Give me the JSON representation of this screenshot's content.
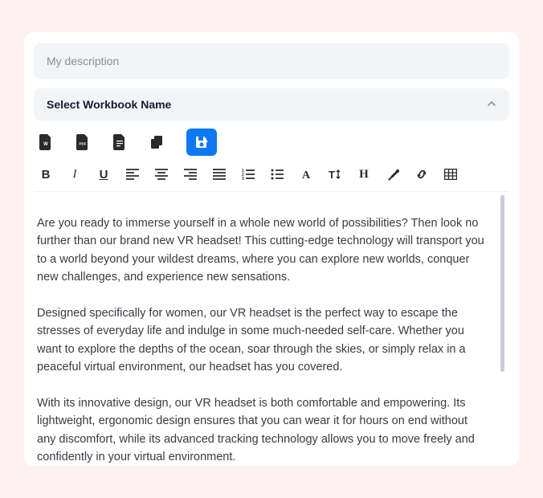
{
  "description": {
    "placeholder": "My description"
  },
  "workbook": {
    "label": "Select Workbook Name"
  },
  "export_icons": [
    {
      "name": "word"
    },
    {
      "name": "pdf"
    },
    {
      "name": "doc"
    },
    {
      "name": "copy"
    },
    {
      "name": "save",
      "active": true
    }
  ],
  "toolbar": {
    "bold": "B",
    "italic": "I",
    "underline": "U",
    "heading": "H"
  },
  "content": {
    "p1": "Are you ready to immerse yourself in a whole new world of possibilities? Then look no further than our brand new VR headset! This cutting-edge technology will transport you to a world beyond your wildest dreams, where you can explore new worlds, conquer new challenges, and experience new sensations.",
    "p2": "Designed specifically for women, our VR headset is the perfect way to escape the stresses of everyday life and indulge in some much-needed self-care. Whether you want to explore the depths of the ocean, soar through the skies, or simply relax in a peaceful virtual environment, our headset has you covered.",
    "p3": "With its innovative design, our VR headset is both comfortable and empowering. Its lightweight, ergonomic design ensures that you can wear it for hours on end without any discomfort, while its advanced tracking technology allows you to move freely and confidently in your virtual environment."
  }
}
